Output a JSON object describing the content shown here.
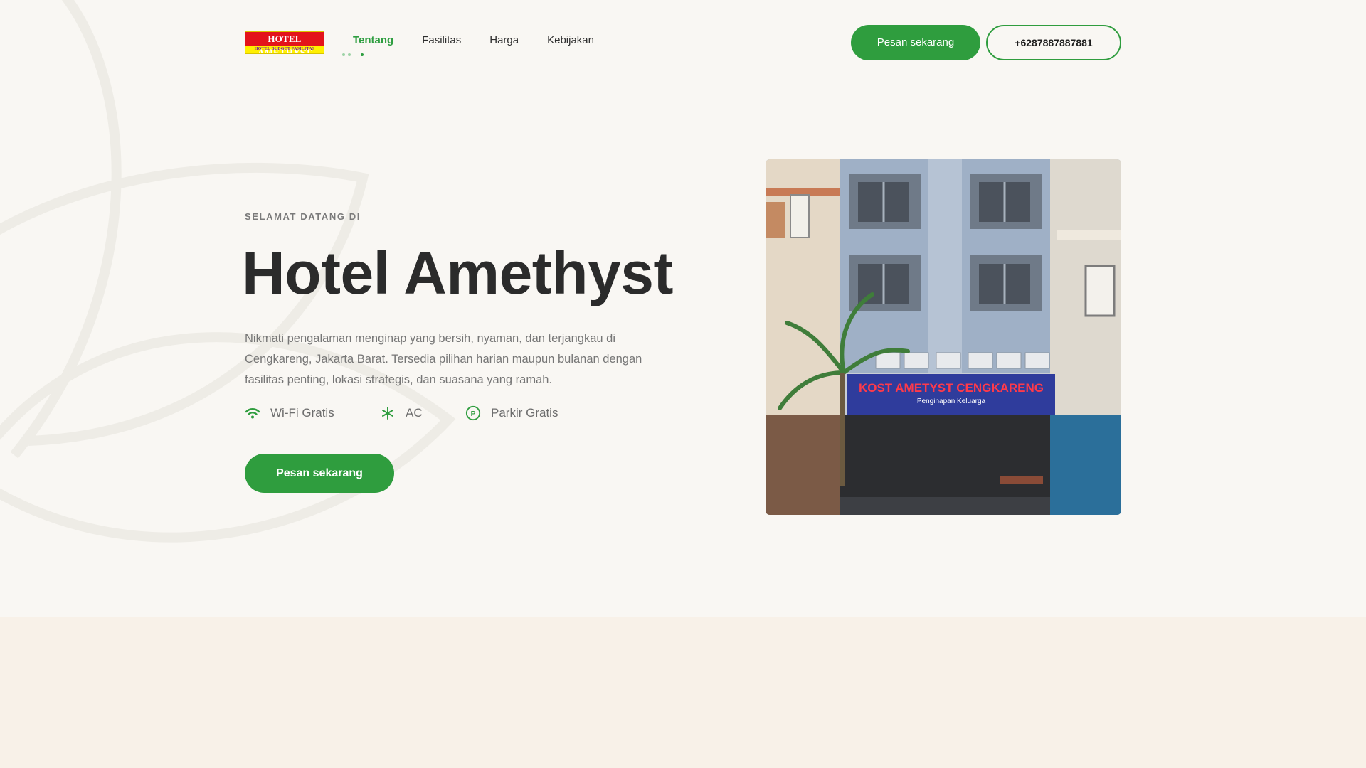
{
  "logo": {
    "title": "HOTEL AMETHYST",
    "tagline": "HOTEL BUDGET FASILITAS BINTANG 5",
    "banner_title": "KOST AMETYST CENGKARENG",
    "banner_subtitle": "Penginapan Keluarga"
  },
  "nav": {
    "items": [
      {
        "label": "Tentang",
        "active": true
      },
      {
        "label": "Fasilitas",
        "active": false
      },
      {
        "label": "Harga",
        "active": false
      },
      {
        "label": "Kebijakan",
        "active": false
      }
    ]
  },
  "header": {
    "book_label": "Pesan sekarang",
    "phone_label": "+6287887887881"
  },
  "hero": {
    "eyebrow": "SELAMAT DATANG DI",
    "title": "Hotel Amethyst",
    "description": "Nikmati pengalaman menginap yang bersih, nyaman, dan terjangkau di Cengkareng, Jakarta Barat. Tersedia pilihan harian maupun bulanan dengan fasilitas penting, lokasi strategis, dan suasana yang ramah.",
    "features": [
      {
        "icon": "wifi-icon",
        "label": "Wi-Fi Gratis"
      },
      {
        "icon": "snowflake-icon",
        "label": "AC"
      },
      {
        "icon": "parking-icon",
        "label": "Parkir Gratis"
      }
    ],
    "cta_label": "Pesan sekarang"
  },
  "colors": {
    "accent": "#2f9d3e",
    "background": "#f9f7f3",
    "lower_band": "#f8f1e8",
    "text_dark": "#2b2b2b",
    "text_muted": "#767676"
  }
}
